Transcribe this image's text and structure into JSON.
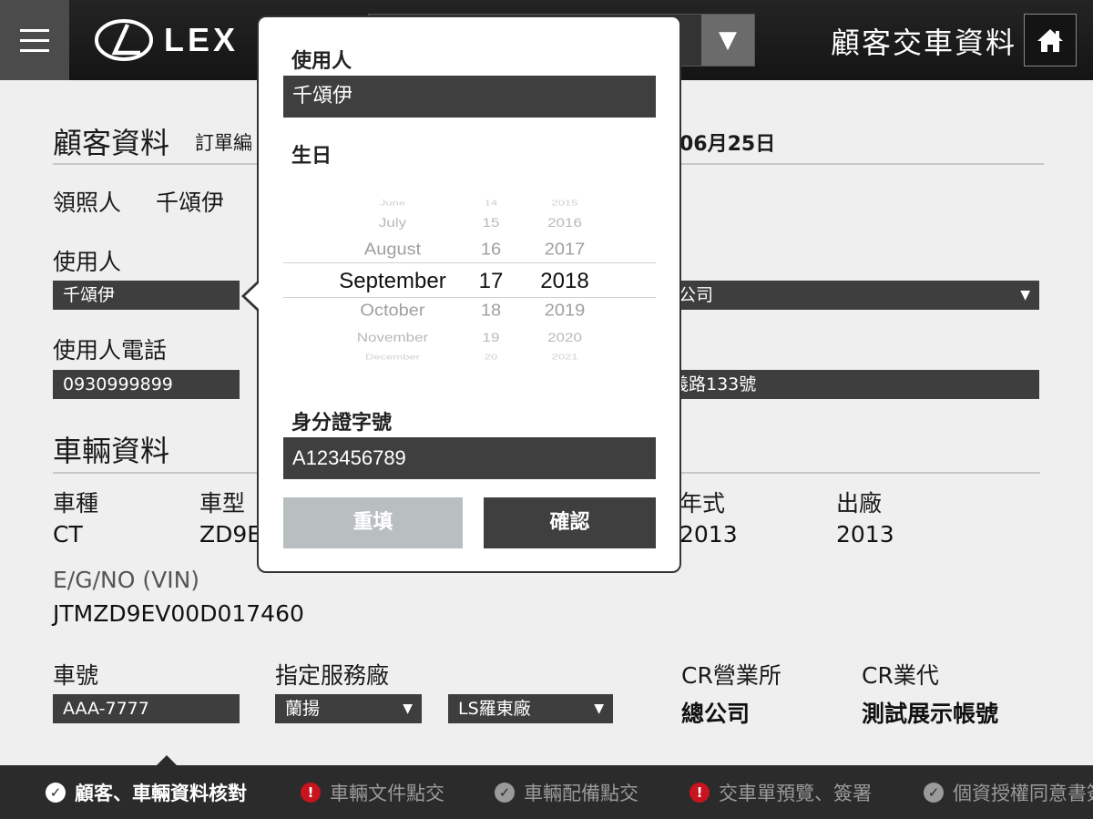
{
  "header": {
    "brand": "LEX",
    "title": "顧客交車資料",
    "dropdown_arrow": "▼"
  },
  "customer": {
    "section_title": "顧客資料",
    "order_label_partial": "訂單編",
    "date_partial": "06月25日",
    "licensee_label": "領照人",
    "licensee_value": "千頌伊",
    "user_label": "使用人",
    "user_value": "千頌伊",
    "phone_label": "使用人電話",
    "phone_value": "0930999899",
    "company_partial": "公司",
    "address_partial": "義路133號"
  },
  "vehicle": {
    "section_title": "車輛資料",
    "kind_label": "車種",
    "kind_value": "CT",
    "model_label": "車型",
    "model_value_partial": "ZD9E",
    "year_label_partial": "年式",
    "year_value": "2013",
    "factory_label": "出廠",
    "factory_value": "2013",
    "vin_label": "E/G/NO (VIN)",
    "vin_value": "JTMZD9EV00D017460",
    "plate_label": "車號",
    "plate_value": "AAA-7777",
    "service_label": "指定服務廠",
    "service_region": "蘭揚",
    "service_factory": "LS羅東廠",
    "cr_office_label": "CR營業所",
    "cr_office_value": "總公司",
    "cr_agent_label": "CR業代",
    "cr_agent_value": "測試展示帳號"
  },
  "popover": {
    "user_label": "使用人",
    "user_value": "千頌伊",
    "birthday_label": "生日",
    "id_label": "身分證字號",
    "id_value": "A123456789",
    "reset_button": "重填",
    "confirm_button": "確認",
    "picker": {
      "months": [
        "June",
        "July",
        "August",
        "September",
        "October",
        "November",
        "December"
      ],
      "days": [
        "14",
        "15",
        "16",
        "17",
        "18",
        "19",
        "20"
      ],
      "years": [
        "2015",
        "2016",
        "2017",
        "2018",
        "2019",
        "2020",
        "2021"
      ],
      "selected": {
        "month": "September",
        "day": "17",
        "year": "2018"
      }
    }
  },
  "steps": [
    {
      "label": "顧客、車輛資料核對",
      "status": "complete",
      "icon": "check-circle-icon"
    },
    {
      "label": "車輛文件點交",
      "status": "warning",
      "icon": "alert-circle-icon"
    },
    {
      "label": "車輛配備點交",
      "status": "pending",
      "icon": "check-circle-icon"
    },
    {
      "label": "交車單預覽、簽署",
      "status": "warning",
      "icon": "alert-circle-icon"
    },
    {
      "label": "個資授權同意書簽",
      "status": "pending",
      "icon": "check-circle-icon"
    }
  ],
  "colors": {
    "warning": "#c8141e",
    "dark_field": "#3e3e3e",
    "disabled_button": "#b9bec1",
    "confirm_button": "#3f3f3f"
  }
}
